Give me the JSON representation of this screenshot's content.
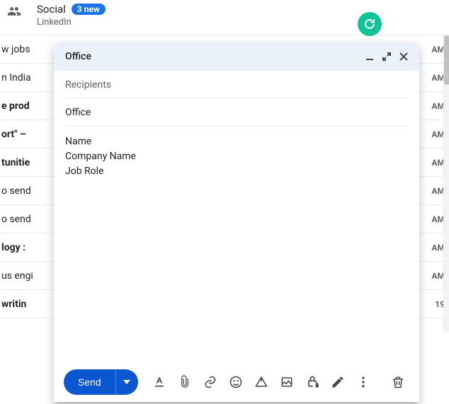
{
  "social": {
    "title": "Social",
    "badge": "3 new",
    "sub": "LinkedIn"
  },
  "rows": [
    {
      "snippet": "w jobs",
      "time": "AM",
      "bold": false
    },
    {
      "snippet": "n India",
      "time": "AM",
      "bold": false
    },
    {
      "snippet": "e prod",
      "time": "AM",
      "bold": true
    },
    {
      "snippet": "ort\" –",
      "time": "AM",
      "bold": true
    },
    {
      "snippet": "tunitie",
      "time": "AM",
      "bold": true
    },
    {
      "snippet": "o send",
      "time": "AM",
      "bold": false
    },
    {
      "snippet": "o send",
      "time": "AM",
      "bold": false
    },
    {
      "snippet": "logy :",
      "time": "AM",
      "bold": true
    },
    {
      "snippet": "us engi",
      "time": "AM",
      "bold": false
    },
    {
      "snippet": "writin",
      "time": "19",
      "bold": true
    }
  ],
  "compose": {
    "title": "Office",
    "recipients_placeholder": "Recipients",
    "subject": "Office",
    "body_lines": [
      "Name",
      "Company Name",
      "Job Role"
    ],
    "send_label": "Send"
  }
}
